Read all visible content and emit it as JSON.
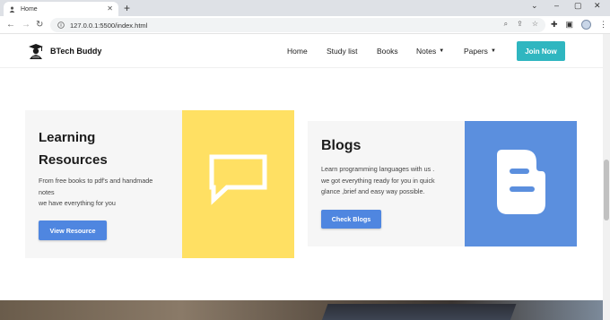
{
  "browser": {
    "tab_title": "Home",
    "address": "127.0.0.1:5500/index.html"
  },
  "nav": {
    "brand": "BTech Buddy",
    "items": [
      "Home",
      "Study list",
      "Books",
      "Notes",
      "Papers"
    ],
    "join_label": "Join Now"
  },
  "card_resources": {
    "title_line1": "Learning",
    "title_line2": "Resources",
    "text_line1": "From free books to pdf's and handmade",
    "text_line2": "notes",
    "text_line3": "we have everything for you",
    "button_label": "View Resource",
    "accent": "#ffe063",
    "icon": "speech-bubble-icon"
  },
  "card_blogs": {
    "title": "Blogs",
    "text_line1": "Learn programming languages with us .",
    "text_line2": "we got everything ready for you in quick",
    "text_line3": "glance ,brief and easy way possible.",
    "button_label": "Check Blogs",
    "accent": "#5b8fde",
    "icon": "blogger-icon"
  },
  "colors": {
    "join_button": "#2fb6c0",
    "primary_button": "#4f86e0"
  }
}
